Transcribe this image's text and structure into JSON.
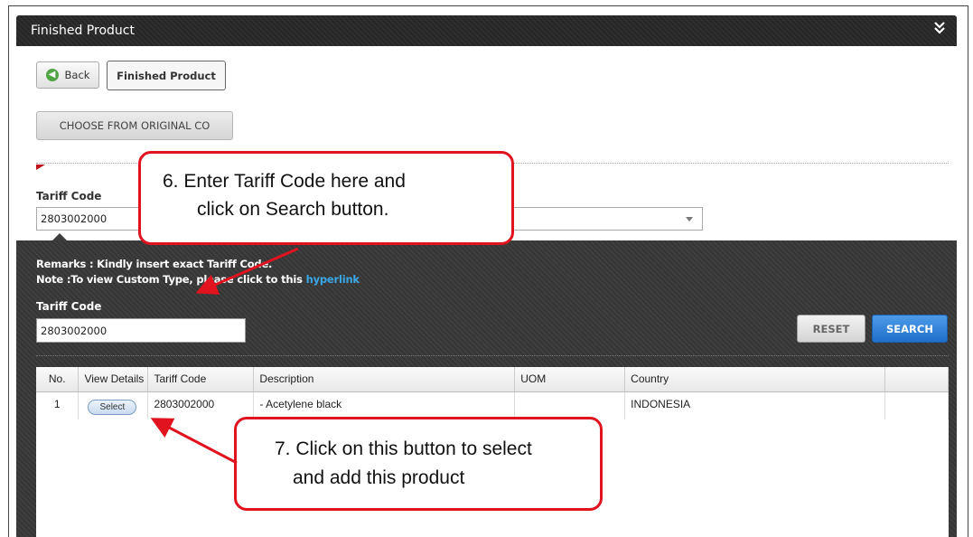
{
  "panel": {
    "title": "Finished Product",
    "collapse_glyph": "»"
  },
  "toolbar": {
    "back_label": "Back",
    "finished_product_label": "Finished Product",
    "choose_label": "CHOOSE FROM ORIGINAL CO"
  },
  "form": {
    "tariff_label": "Tariff Code",
    "tariff_value": "2803002000"
  },
  "search": {
    "remarks": "Remarks : Kindly insert exact Tariff Code.",
    "note_prefix": "Note :To view Custom Type, please click to this ",
    "note_link": "hyperlink",
    "tariff_label": "Tariff Code",
    "tariff_value": "2803002000",
    "reset_label": "RESET",
    "search_label": "SEARCH"
  },
  "table": {
    "headers": [
      "No.",
      "View Details",
      "Tariff Code",
      "Description",
      "UOM",
      "Country",
      ""
    ],
    "rows": [
      {
        "no": "1",
        "view": "Select",
        "code": "2803002000",
        "description": "- Acetylene black",
        "uom": "",
        "country": "INDONESIA"
      }
    ]
  },
  "callouts": {
    "step6_line1": "6.  Enter Tariff Code here and",
    "step6_line2": "click on Search button.",
    "step7_line1": "7. Click on this button to select",
    "step7_line2": "and add this product"
  },
  "colors": {
    "callout_border": "#e0131f",
    "search_button": "#1f6fcc",
    "link": "#39a7e6"
  },
  "icons": {
    "back": "circle-arrow-left-icon",
    "collapse": "double-chevron-icon",
    "dropdown": "caret-down-icon"
  }
}
